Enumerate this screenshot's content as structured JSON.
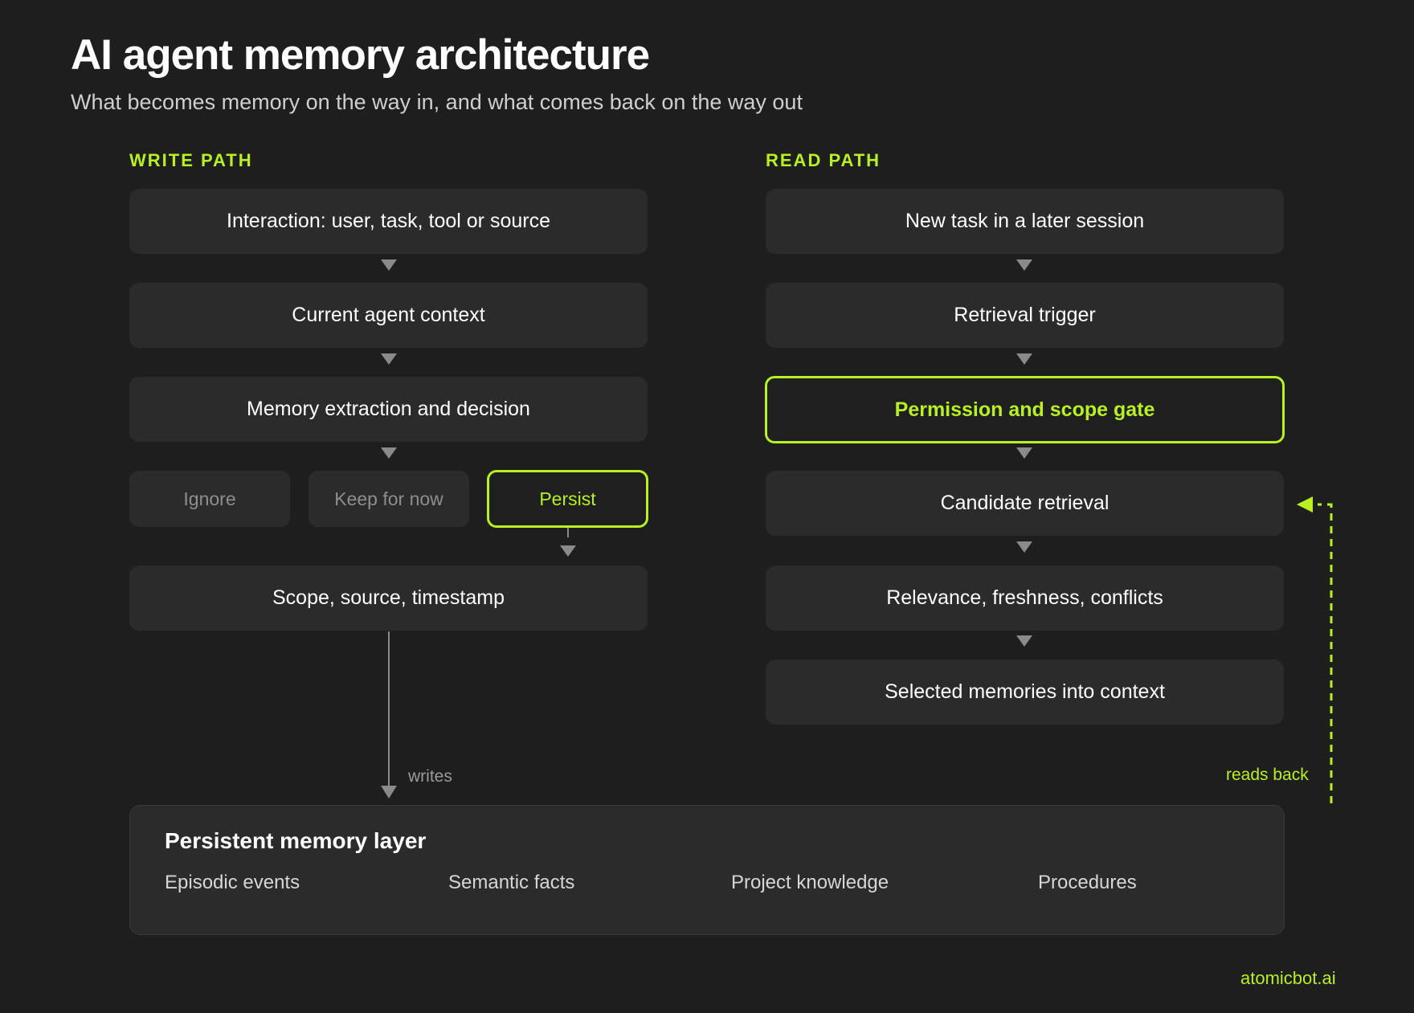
{
  "header": {
    "title": "AI agent memory architecture",
    "subtitle": "What becomes memory on the way in, and what comes back on the way out"
  },
  "write_path": {
    "label": "WRITE PATH",
    "steps": [
      "Interaction: user, task, tool or source",
      "Current agent context",
      "Memory extraction and decision"
    ],
    "options": [
      "Ignore",
      "Keep for now",
      "Persist"
    ],
    "final_step": "Scope, source, timestamp",
    "edge_label": "writes"
  },
  "read_path": {
    "label": "READ PATH",
    "steps": [
      "New task in a later session",
      "Retrieval trigger",
      "Permission and scope gate",
      "Candidate retrieval",
      "Relevance, freshness, conflicts",
      "Selected memories into context"
    ],
    "edge_label": "reads back"
  },
  "memory_layer": {
    "title": "Persistent memory layer",
    "items": [
      "Episodic events",
      "Semantic facts",
      "Project knowledge",
      "Procedures"
    ]
  },
  "footer": {
    "brand": "atomicbot.ai"
  },
  "colors": {
    "accent": "#b8f020",
    "background": "#1e1e1e",
    "box": "#2b2b2b"
  }
}
